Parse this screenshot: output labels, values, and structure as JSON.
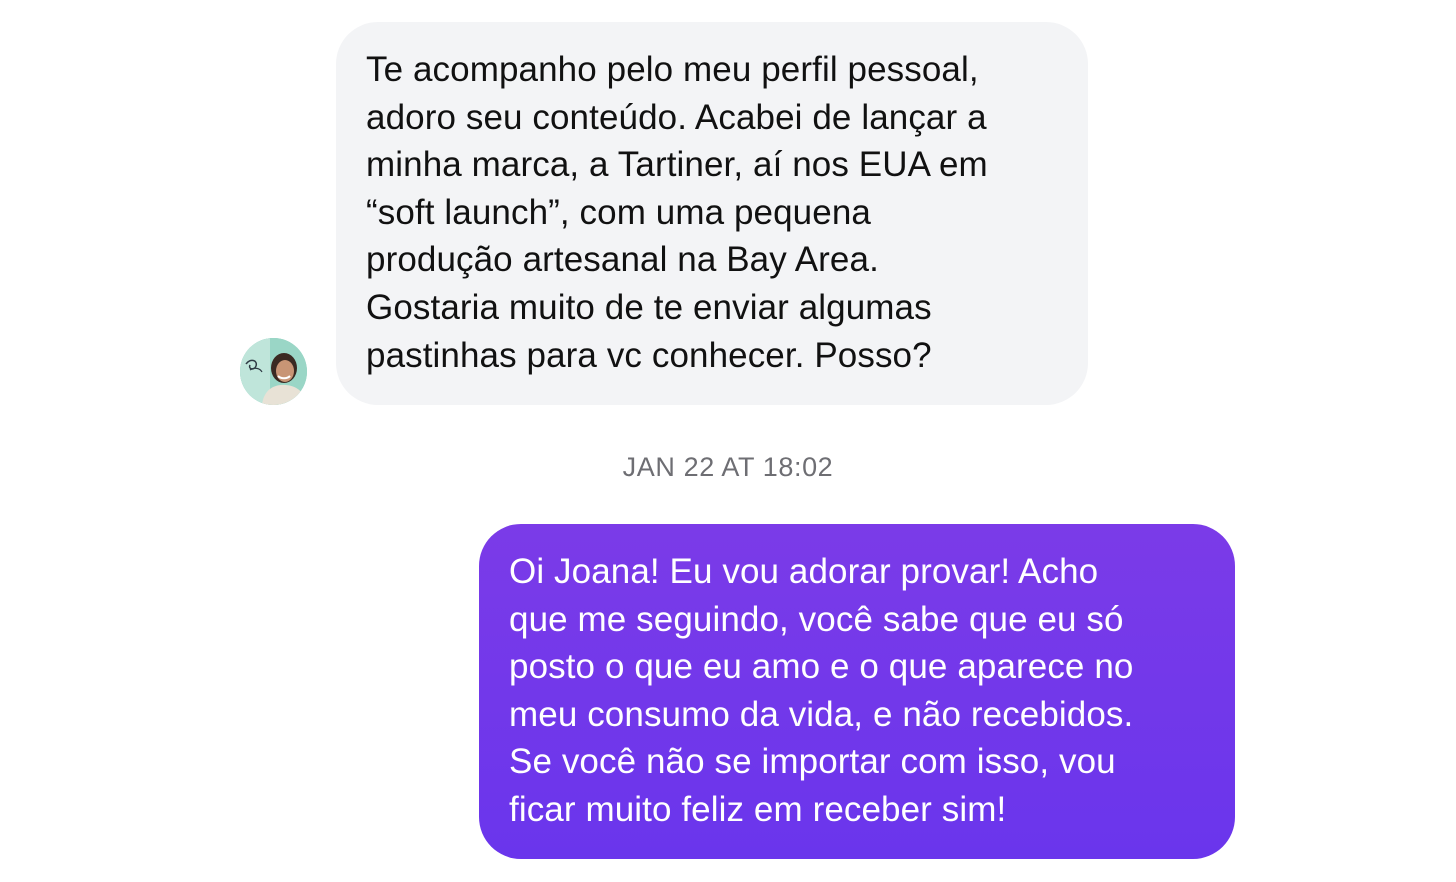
{
  "conversation": {
    "incoming_message": {
      "sender_avatar": "profile-photo",
      "lines": [
        "Te acompanho pelo meu perfil pessoal,",
        "adoro seu conteúdo. Acabei de lançar a",
        "minha marca, a Tartiner, aí nos EUA em",
        "“soft launch”, com uma pequena",
        "produção artesanal na Bay Area.",
        "Gostaria muito de te enviar algumas",
        "pastinhas para vc conhecer. Posso?"
      ]
    },
    "timestamp": "JAN 22 AT 18:02",
    "outgoing_message": {
      "lines": [
        "Oi Joana! Eu vou adorar provar! Acho",
        "que me seguindo, você sabe que eu só",
        "posto o que eu amo e o que aparece no",
        "meu consumo da vida, e não recebidos.",
        "Se você não se importar com isso, vou",
        "ficar muito feliz em receber sim!"
      ]
    }
  },
  "colors": {
    "incoming_bubble": "#f3f4f6",
    "outgoing_bubble": "#7038eb",
    "timestamp_text": "#6e6e73"
  }
}
